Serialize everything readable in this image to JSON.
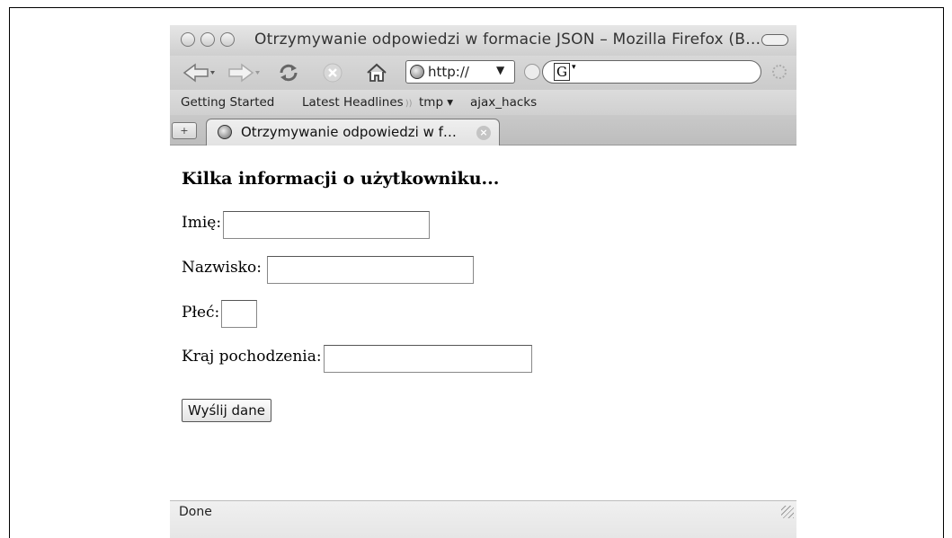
{
  "window": {
    "title": "Otrzymywanie odpowiedzi w formacie JSON – Mozilla Firefox (B…"
  },
  "navbar": {
    "url": "http://",
    "search_engine": "G"
  },
  "bookmarks": [
    "Getting Started",
    "Latest Headlines",
    "tmp ▾",
    "ajax_hacks"
  ],
  "tab": {
    "label": "Otrzymywanie odpowiedzi w f…"
  },
  "page": {
    "heading": "Kilka informacji o użytkowniku...",
    "fields": [
      {
        "label": "Imię:",
        "value": ""
      },
      {
        "label": "Nazwisko:",
        "value": ""
      },
      {
        "label": "Płeć:",
        "value": ""
      },
      {
        "label": "Kraj pochodzenia:",
        "value": ""
      }
    ],
    "submit_label": "Wyślij dane"
  },
  "status": "Done"
}
